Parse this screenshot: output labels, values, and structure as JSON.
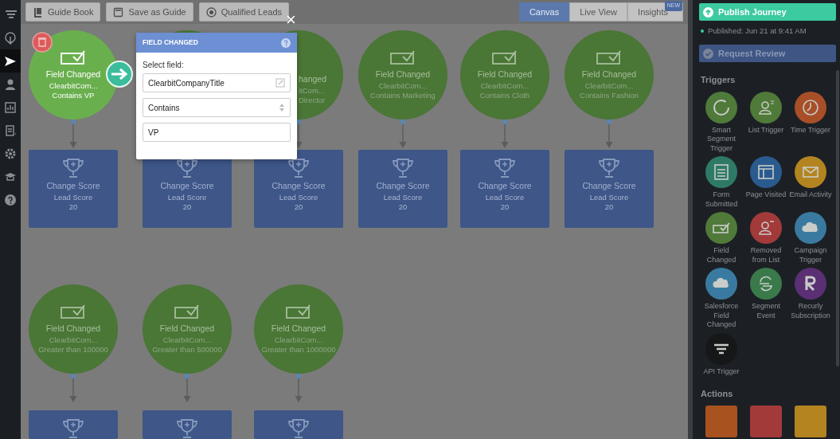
{
  "rail": [
    {
      "kind": "menu",
      "selected": false
    },
    {
      "kind": "download",
      "selected": false
    },
    {
      "kind": "send",
      "selected": true
    },
    {
      "kind": "person",
      "selected": false
    },
    {
      "kind": "chart",
      "selected": false
    },
    {
      "kind": "list",
      "selected": false
    },
    {
      "kind": "gear",
      "selected": false
    },
    {
      "kind": "cap",
      "selected": false
    },
    {
      "kind": "help",
      "selected": false
    }
  ],
  "toolbar": {
    "buttons": [
      {
        "kind": "book",
        "label": "Guide Book"
      },
      {
        "kind": "save",
        "label": "Save as Guide"
      },
      {
        "kind": "target",
        "label": "Qualified Leads"
      }
    ],
    "views": [
      {
        "label": "Canvas",
        "selected": true
      },
      {
        "label": "Live View",
        "selected": false
      },
      {
        "label": "Insights",
        "selected": false,
        "badge": "NEW"
      }
    ]
  },
  "canvas": {
    "rows": [
      {
        "nodes": [
          {
            "kind": "field",
            "selected": true,
            "title": "Field Changed",
            "lines": [
              "ClearbitCom...",
              "Contains VP"
            ]
          },
          {
            "kind": "covered",
            "selected": false
          },
          {
            "kind": "partial",
            "selected": false,
            "title": "hanged",
            "lines": [
              "itCom...",
              "Director"
            ]
          },
          {
            "kind": "field",
            "selected": false,
            "title": "Field Changed",
            "lines": [
              "ClearbitCom...",
              "Contains Marketing"
            ]
          },
          {
            "kind": "field",
            "selected": false,
            "title": "Field Changed",
            "lines": [
              "ClearbitCom...",
              "Contains Cloth"
            ]
          },
          {
            "kind": "field",
            "selected": false,
            "title": "Field Changed",
            "lines": [
              "ClearbitCom...",
              "Contains Fashion"
            ]
          }
        ],
        "cards": [
          {
            "title": "Change Score",
            "lines": [
              "Lead Score",
              "20"
            ]
          },
          {
            "title": "Change Score",
            "lines": [
              "Lead Score",
              "20"
            ]
          },
          {
            "title": "Change Score",
            "lines": [
              "Lead Score",
              "20"
            ]
          },
          {
            "title": "Change Score",
            "lines": [
              "Lead Score",
              "20"
            ]
          },
          {
            "title": "Change Score",
            "lines": [
              "Lead Score",
              "20"
            ]
          },
          {
            "title": "Change Score",
            "lines": [
              "Lead Score",
              "20"
            ]
          }
        ]
      },
      {
        "nodes": [
          {
            "kind": "field",
            "selected": false,
            "title": "Field Changed",
            "lines": [
              "ClearbitCom...",
              "Greater than 100000"
            ]
          },
          {
            "kind": "field",
            "selected": false,
            "title": "Field Changed",
            "lines": [
              "ClearbitCom...",
              "Greater than 500000"
            ]
          },
          {
            "kind": "field",
            "selected": false,
            "title": "Field Changed",
            "lines": [
              "ClearbitCom...",
              "Greater than 1000000"
            ]
          }
        ],
        "cards": [
          {
            "kind": "score"
          },
          {
            "kind": "score"
          },
          {
            "kind": "score"
          }
        ]
      }
    ]
  },
  "modal": {
    "title": "FIELD CHANGED",
    "close": "×",
    "field_label": "Select field:",
    "field": {
      "value": "ClearbitCompanyTitle"
    },
    "operator": {
      "value": "Contains"
    },
    "match": {
      "value": "VP"
    }
  },
  "sidebar": {
    "publish": "Publish Journey",
    "published": "Published: Jun 21 at 9:41 AM",
    "review": "Request Review",
    "triggers_heading": "Triggers",
    "triggers": [
      {
        "kind": "segment",
        "label": "Smart Segment Trigger",
        "color": "#4f7a3a"
      },
      {
        "kind": "list",
        "label": "List Trigger",
        "color": "#4f7a3a"
      },
      {
        "kind": "time",
        "label": "Time Trigger",
        "color": "#a84f28"
      },
      {
        "kind": "form",
        "label": "Form Submitted",
        "color": "#2e7a66"
      },
      {
        "kind": "page",
        "label": "Page Visited",
        "color": "#2b5a8f"
      },
      {
        "kind": "email",
        "label": "Email Activity",
        "color": "#b38420"
      },
      {
        "kind": "field",
        "label": "Field Changed",
        "color": "#4f7a3a"
      },
      {
        "kind": "removed",
        "label": "Removed from List",
        "color": "#a33a3a"
      },
      {
        "kind": "cloud",
        "label": "Campaign Trigger",
        "color": "#3a7aa0"
      },
      {
        "kind": "cloud",
        "label": "Salesforce Field Changed",
        "color": "#3a7aa0"
      },
      {
        "kind": "event",
        "label": "Segment Event",
        "color": "#3a7a4a"
      },
      {
        "kind": "letter",
        "label": "Recurly Subscription",
        "color": "#5a2f73"
      },
      {
        "kind": "api",
        "label": "API Trigger",
        "color": "#151719"
      }
    ],
    "actions_heading": "Actions",
    "actions": [
      {
        "color": "#a8521f"
      },
      {
        "color": "#a33a3a"
      },
      {
        "color": "#b38420"
      }
    ]
  }
}
